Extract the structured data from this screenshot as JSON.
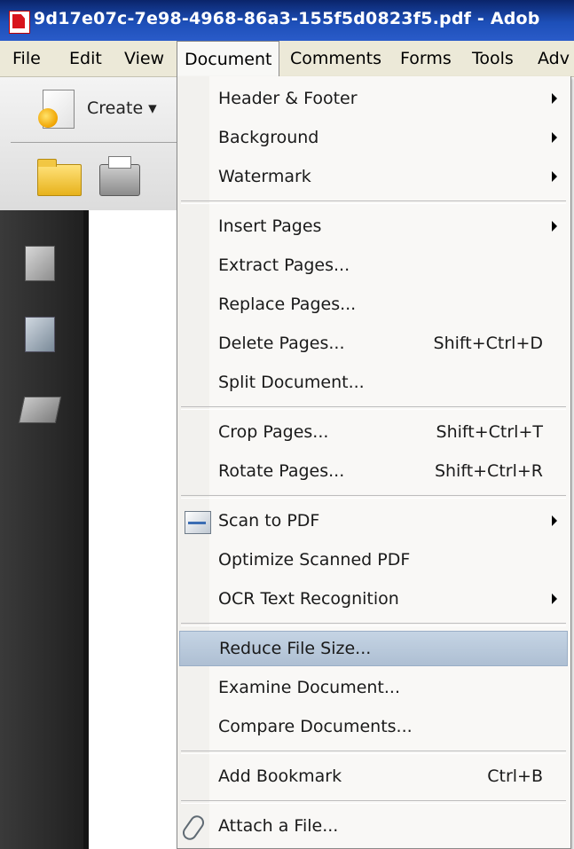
{
  "window": {
    "title": "9d17e07c-7e98-4968-86a3-155f5d0823f5.pdf - Adob"
  },
  "menubar": {
    "items": [
      {
        "label": "File"
      },
      {
        "label": "Edit"
      },
      {
        "label": "View"
      },
      {
        "label": "Document"
      },
      {
        "label": "Comments"
      },
      {
        "label": "Forms"
      },
      {
        "label": "Tools"
      },
      {
        "label": "Adv"
      }
    ]
  },
  "toolbar": {
    "create_label": "Create ▾"
  },
  "document_menu": {
    "items": [
      {
        "label": "Header & Footer",
        "shortcut": "",
        "submenu": true
      },
      {
        "label": "Background",
        "shortcut": "",
        "submenu": true
      },
      {
        "label": "Watermark",
        "shortcut": "",
        "submenu": true
      },
      {
        "label": "Insert Pages",
        "shortcut": "",
        "submenu": true
      },
      {
        "label": "Extract Pages...",
        "shortcut": ""
      },
      {
        "label": "Replace Pages...",
        "shortcut": ""
      },
      {
        "label": "Delete Pages...",
        "shortcut": "Shift+Ctrl+D"
      },
      {
        "label": "Split Document...",
        "shortcut": ""
      },
      {
        "label": "Crop Pages...",
        "shortcut": "Shift+Ctrl+T"
      },
      {
        "label": "Rotate Pages...",
        "shortcut": "Shift+Ctrl+R"
      },
      {
        "label": "Scan to PDF",
        "shortcut": "",
        "submenu": true,
        "icon": "scan-icon"
      },
      {
        "label": "Optimize Scanned PDF",
        "shortcut": ""
      },
      {
        "label": "OCR Text Recognition",
        "shortcut": "",
        "submenu": true
      },
      {
        "label": "Reduce File Size...",
        "shortcut": "",
        "highlighted": true
      },
      {
        "label": "Examine Document...",
        "shortcut": ""
      },
      {
        "label": "Compare Documents...",
        "shortcut": ""
      },
      {
        "label": "Add Bookmark",
        "shortcut": "Ctrl+B"
      },
      {
        "label": "Attach a File...",
        "shortcut": "",
        "icon": "paperclip-icon"
      }
    ]
  },
  "colors": {
    "title_bar": "#0a246a",
    "menu_bg": "#f9f8f6",
    "highlight": "#b9c9db",
    "nav_panel": "#2a2a2a"
  }
}
